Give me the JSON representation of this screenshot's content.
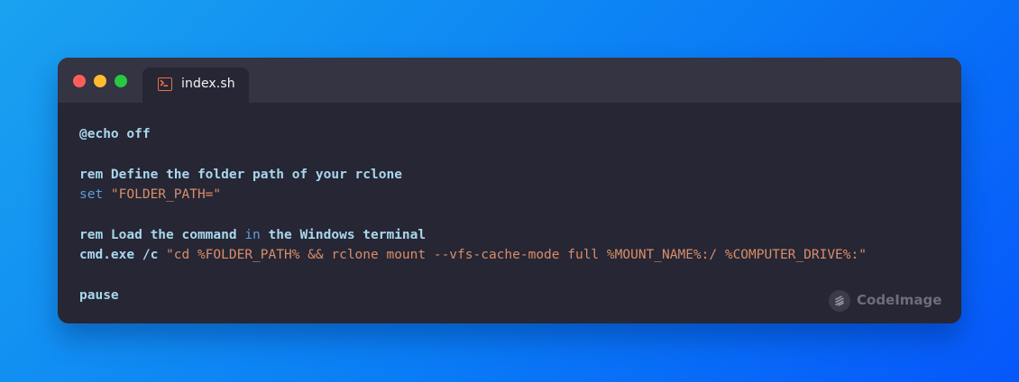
{
  "window": {
    "controls": [
      "close",
      "minimize",
      "maximize"
    ],
    "tab": {
      "label": "index.sh",
      "icon": "terminal-icon"
    }
  },
  "code": {
    "lines": [
      [
        {
          "text": "@echo off",
          "kind": "plain"
        }
      ],
      [],
      [
        {
          "text": "rem Define the folder path of your rclone",
          "kind": "plain"
        }
      ],
      [
        {
          "text": "set ",
          "kind": "kw"
        },
        {
          "text": "\"FOLDER_PATH=\"",
          "kind": "str"
        }
      ],
      [],
      [
        {
          "text": "rem Load the command ",
          "kind": "plain"
        },
        {
          "text": "in",
          "kind": "kw"
        },
        {
          "text": " the Windows terminal",
          "kind": "plain"
        }
      ],
      [
        {
          "text": "cmd.exe /c ",
          "kind": "plain"
        },
        {
          "text": "\"cd %FOLDER_PATH% && rclone mount --vfs-cache-mode full %MOUNT_NAME%:/ %COMPUTER_DRIVE%:\"",
          "kind": "str"
        }
      ],
      [],
      [
        {
          "text": "pause",
          "kind": "plain"
        }
      ]
    ]
  },
  "watermark": {
    "label": "CodeImage",
    "icon": "codeimage-logo-icon"
  },
  "colors": {
    "background_gradient": [
      "#1aa2f0",
      "#0657fb"
    ],
    "window_bg": "#262634",
    "titlebar_bg": "#343443",
    "close": "#ff5f57",
    "minimize": "#febc2e",
    "maximize": "#28c840",
    "plain_text": "#a9d7ec",
    "keyword": "#5c9fd6",
    "string": "#d98e6a",
    "tab_icon": "#e8734a"
  }
}
